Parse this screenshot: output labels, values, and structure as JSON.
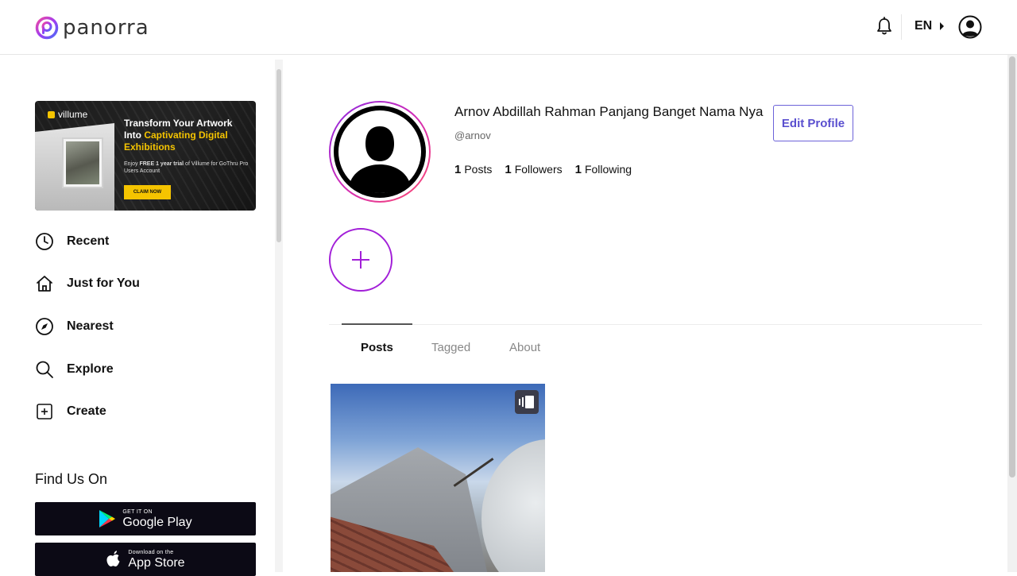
{
  "header": {
    "logo_text": "panorra",
    "language": "EN"
  },
  "sidebar": {
    "banner": {
      "brand": "villume",
      "title_line1": "Transform Your Artwork",
      "title_into": "Into ",
      "title_highlight": "Captivating Digital Exhibitions",
      "sub_prefix": "Enjoy ",
      "sub_bold": "FREE 1 year trial",
      "sub_rest": " of Villume for GoThru Pro Users Account",
      "cta": "CLAIM NOW"
    },
    "nav": [
      {
        "label": "Recent",
        "icon": "clock-icon"
      },
      {
        "label": "Just for You",
        "icon": "home-icon"
      },
      {
        "label": "Nearest",
        "icon": "navigation-icon"
      },
      {
        "label": "Explore",
        "icon": "search-icon"
      },
      {
        "label": "Create",
        "icon": "plus-square-icon"
      }
    ],
    "find_us_title": "Find Us On",
    "google_play": {
      "small": "GET IT ON",
      "big": "Google Play"
    },
    "app_store": {
      "small": "Download on the",
      "big": "App Store"
    }
  },
  "profile": {
    "name": "Arnov Abdillah Rahman Panjang Banget Nama Nya",
    "username": "@arnov",
    "edit_label": "Edit Profile",
    "stats": [
      {
        "count": "1",
        "label": "Posts"
      },
      {
        "count": "1",
        "label": "Followers"
      },
      {
        "count": "1",
        "label": "Following"
      }
    ]
  },
  "tabs": [
    {
      "label": "Posts",
      "active": true
    },
    {
      "label": "Tagged",
      "active": false
    },
    {
      "label": "About",
      "active": false
    }
  ],
  "colors": {
    "accent": "#a21fd8",
    "edit_button": "#5a4fcf",
    "store_bg": "#0c0a15",
    "banner_highlight": "#f5c400"
  }
}
